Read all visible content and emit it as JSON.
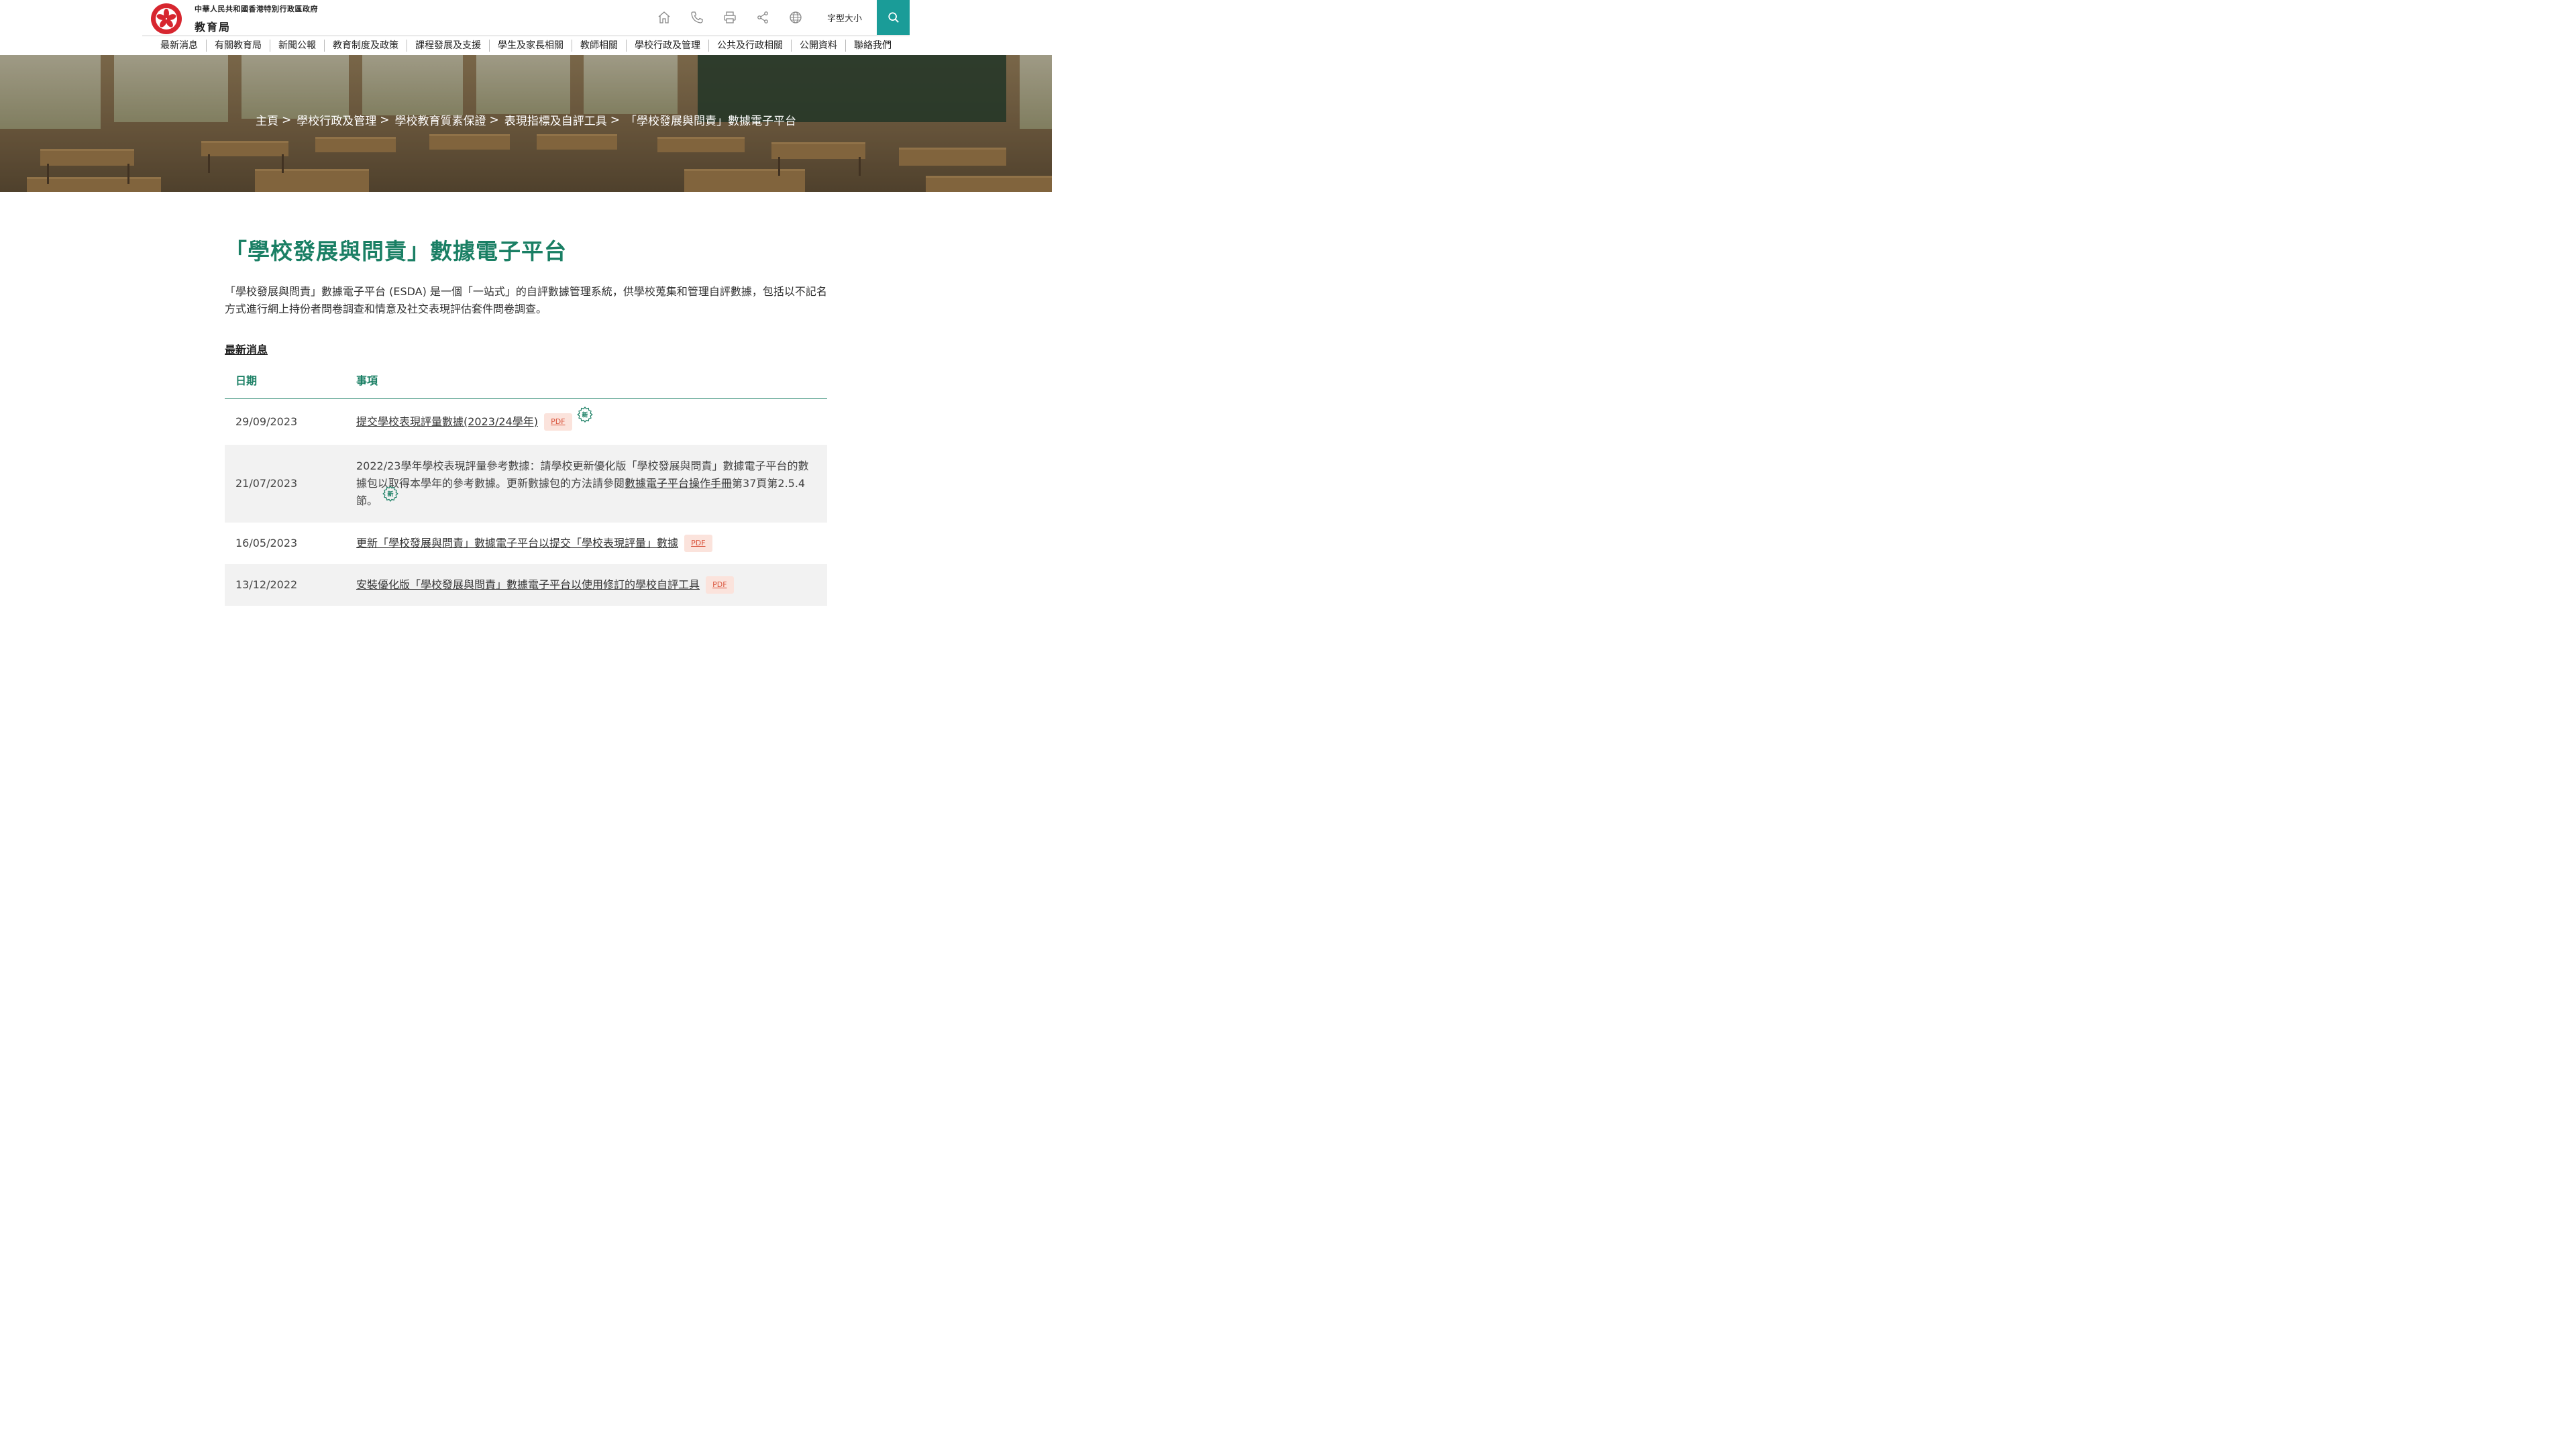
{
  "header": {
    "logo_line1": "中華人民共和國香港特別行政區政府",
    "logo_line2": "教育局",
    "font_size_label": "字型大小",
    "icons": [
      "home-icon",
      "phone-icon",
      "print-icon",
      "share-icon",
      "globe-icon",
      "search-icon"
    ]
  },
  "nav": {
    "items": [
      "最新消息",
      "有關教育局",
      "新聞公報",
      "教育制度及政策",
      "課程發展及支援",
      "學生及家長相關",
      "教師相關",
      "學校行政及管理",
      "公共及行政相關",
      "公開資料",
      "聯絡我們"
    ]
  },
  "breadcrumb": {
    "items": [
      "主頁",
      "學校行政及管理",
      "學校教育質素保證",
      "表現指標及自評工具",
      "「學校發展與問責」數據電子平台"
    ],
    "separator": ">"
  },
  "page": {
    "title": "「學校發展與問責」數據電子平台",
    "intro": "「學校發展與問責」數據電子平台 (ESDA) 是一個「一站式」的自評數據管理系統，供學校蒐集和管理自評數據，包括以不記名方式進行網上持份者問卷調查和情意及社交表現評估套件問卷調查。",
    "section_heading": "最新消息"
  },
  "news_table": {
    "headers": {
      "date": "日期",
      "item": "事項"
    },
    "pdf_label": "PDF",
    "new_badge": "新",
    "rows": [
      {
        "date": "29/09/2023",
        "link": "提交學校表現評量數據(2023/24學年)"
      },
      {
        "date": "21/07/2023",
        "text_before": "2022/23學年學校表現評量參考數據：請學校更新優化版「學校發展與問責」數據電子平台的數據包以取得本學年的參考數據。更新數據包的方法請參閱",
        "link": "數據電子平台操作手冊",
        "text_after": "第37頁第2.5.4節。"
      },
      {
        "date": "16/05/2023",
        "link": "更新「學校發展與問責」數據電子平台以提交「學校表現評量」數據"
      },
      {
        "date": "13/12/2022",
        "link": "安裝優化版「學校發展與問責」數據電子平台以使用修訂的學校自評工具"
      }
    ]
  },
  "colors": {
    "brand_green": "#1a7f64",
    "search_teal": "#1a9c98",
    "pdf_bg": "#fbe3dc",
    "pdf_text": "#d9533b"
  }
}
